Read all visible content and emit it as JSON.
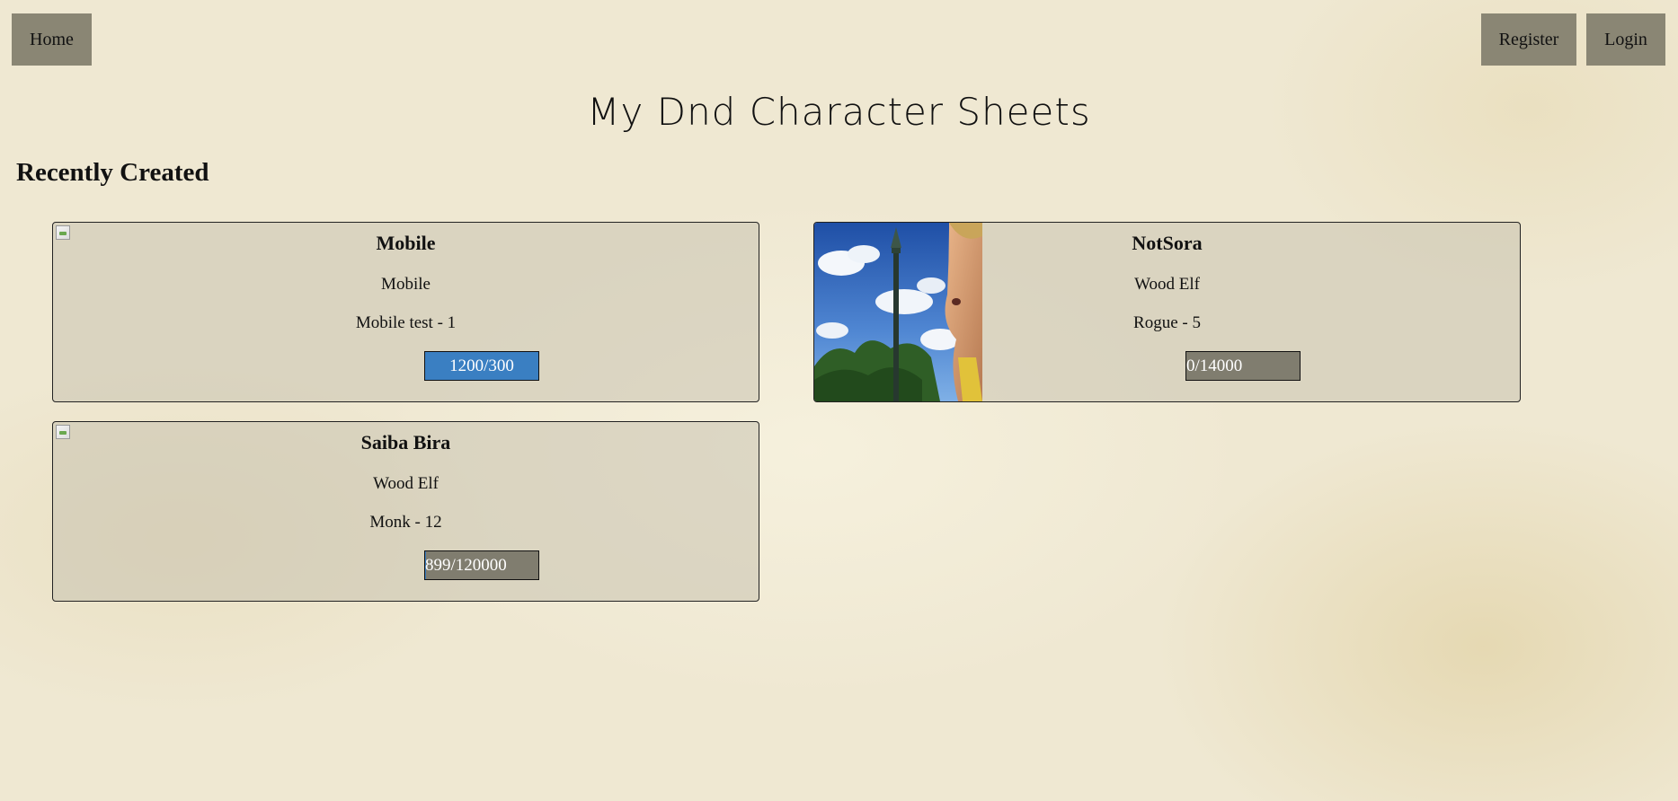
{
  "nav": {
    "home_label": "Home",
    "register_label": "Register",
    "login_label": "Login"
  },
  "page_title": "My Dnd Character Sheets",
  "section_title": "Recently Created",
  "colors": {
    "nav_button_bg": "#8a8674",
    "xp_full": "#3a7fc2",
    "xp_empty": "#807d6f",
    "page_bg": "#efe8d2"
  },
  "cards": [
    {
      "name": "Mobile",
      "race": "Mobile",
      "class_level": "Mobile test - 1",
      "xp_text": "1200/300",
      "xp_progress": 1.0,
      "image": "broken-image"
    },
    {
      "name": "NotSora",
      "race": "Wood Elf",
      "class_level": "Rogue - 5",
      "xp_text": "0/14000",
      "xp_progress": 0.0,
      "image": "character-portrait"
    },
    {
      "name": "Saiba Bira",
      "race": "Wood Elf",
      "class_level": "Monk - 12",
      "xp_text": "899/120000",
      "xp_progress": 0.007,
      "image": "broken-image"
    }
  ]
}
